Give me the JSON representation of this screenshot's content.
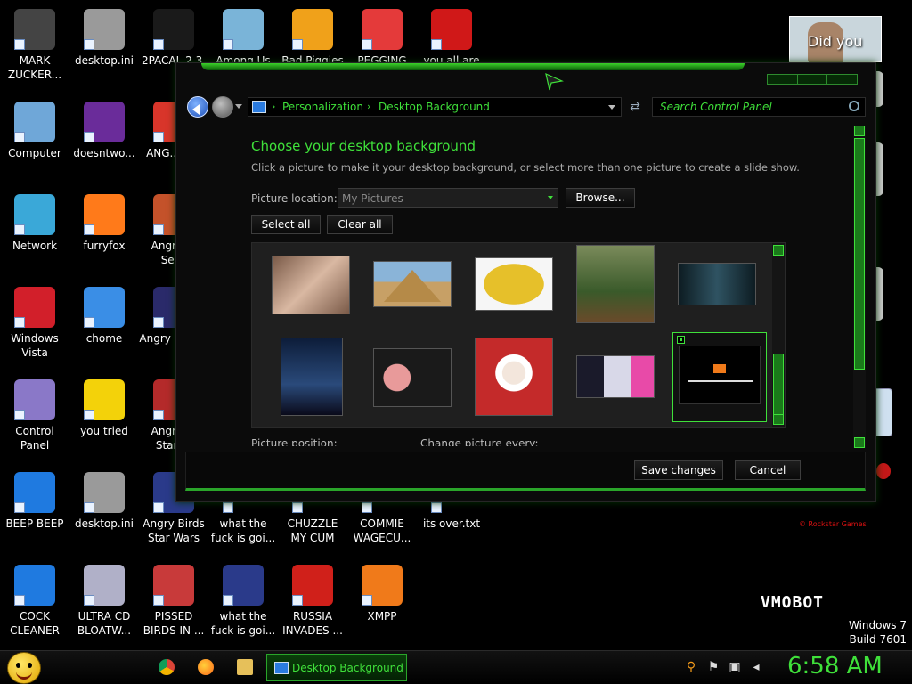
{
  "desktop": {
    "icons": [
      {
        "label": "MARK ZUCKER...",
        "icon": "person-icon",
        "color": "#444444"
      },
      {
        "label": "desktop.ini",
        "icon": "settings-file-icon",
        "color": "#9a9a9a"
      },
      {
        "label": "2PACAL 2.3.",
        "icon": "console-icon",
        "color": "#1a1a1a"
      },
      {
        "label": "Among Us",
        "icon": "game-icon",
        "color": "#7ab4d8"
      },
      {
        "label": "Bad Piggies",
        "icon": "pig-icon",
        "color": "#f0a11a"
      },
      {
        "label": "PEGGING",
        "icon": "p-logo-icon",
        "color": "#e43a3a"
      },
      {
        "label": "you all are",
        "icon": "devcpp-icon",
        "color": "#d01818"
      },
      {
        "label": "Computer",
        "icon": "computer-icon",
        "color": "#6fa7d8"
      },
      {
        "label": "doesntwo...",
        "icon": "yahoo-icon",
        "color": "#6a2c9a"
      },
      {
        "label": "ANG... BIR",
        "icon": "angry-bird-icon",
        "color": "#d8352a"
      },
      {
        "label": "Network",
        "icon": "network-globe-icon",
        "color": "#3aa8d8"
      },
      {
        "label": "furryfox",
        "icon": "firefox-icon",
        "color": "#ff7a1a"
      },
      {
        "label": "Angry ... Seas",
        "icon": "angry-birds-seasons-icon",
        "color": "#c4522a"
      },
      {
        "label": "Windows Vista",
        "icon": "recycle-bin-icon",
        "color": "#d21f2a"
      },
      {
        "label": "chome",
        "icon": "chrome-icon",
        "color": "#3a8ee6"
      },
      {
        "label": "Angry ... Spa",
        "icon": "angry-birds-space-icon",
        "color": "#2a2a6a"
      },
      {
        "label": "Control Panel",
        "icon": "control-panel-icon",
        "color": "#8a78c8"
      },
      {
        "label": "you tried",
        "icon": "star-icon",
        "color": "#f3d20a"
      },
      {
        "label": "Angry ... Star W",
        "icon": "angry-birds-star-wars-icon",
        "color": "#b42a2a"
      },
      {
        "label": "BEEP BEEP",
        "icon": "blue-bar-icon",
        "color": "#1f7ae0"
      },
      {
        "label": "desktop.ini",
        "icon": "settings-file-icon",
        "color": "#9a9a9a"
      },
      {
        "label": "Angry Birds Star Wars",
        "icon": "angry-birds-star-wars-icon",
        "color": "#2a3a8a"
      },
      {
        "label": "what the fuck is goi...",
        "icon": "blank-icon",
        "color": "#000000"
      },
      {
        "label": "CHUZZLE MY CUM",
        "icon": "blank-icon",
        "color": "#000000"
      },
      {
        "label": "COMMIE WAGECU...",
        "icon": "blank-icon",
        "color": "#000000"
      },
      {
        "label": "its over.txt",
        "icon": "blank-icon",
        "color": "#000000"
      },
      {
        "label": "COCK CLEANER",
        "icon": "blue-bar-icon",
        "color": "#1f7ae0"
      },
      {
        "label": "ULTRA CD BLOATW...",
        "icon": "cd-icon",
        "color": "#b0b0c8"
      },
      {
        "label": "PISSED BIRDS IN ...",
        "icon": "angry-bird-icon",
        "color": "#c83a3a"
      },
      {
        "label": "what the fuck is goi...",
        "icon": "angry-birds-space-icon",
        "color": "#2a3a8a"
      },
      {
        "label": "RUSSIA INVADES ...",
        "icon": "radiation-icon",
        "color": "#d0201a"
      },
      {
        "label": "XMPP",
        "icon": "xampp-icon",
        "color": "#f07a1a"
      }
    ],
    "did_you_text": "Did you",
    "watermark_small": "© Rockstar Games",
    "vmobot": "VMOBOT",
    "windows_version": "Windows 7",
    "build": "Build 7601"
  },
  "window": {
    "breadcrumb": [
      "Personalization",
      "Desktop Background"
    ],
    "search_placeholder": "Search Control Panel",
    "title": "Choose your desktop background",
    "subtitle": "Click a picture to make it your desktop background, or select more than one picture to create a slide show.",
    "picture_location_label": "Picture location:",
    "picture_location_value": "My Pictures",
    "browse_label": "Browse...",
    "select_all_label": "Select all",
    "clear_all_label": "Clear all",
    "picture_position_label": "Picture position:",
    "change_picture_label": "Change picture every:",
    "save_label": "Save changes",
    "cancel_label": "Cancel",
    "accent_color": "#3fe03a",
    "thumbnails": [
      {
        "name": "thumb-skin",
        "color": "#c9a58a"
      },
      {
        "name": "thumb-pyramid",
        "color": "#b8a36a"
      },
      {
        "name": "thumb-usa-map",
        "color": "#e6c02a"
      },
      {
        "name": "thumb-saint-portrait",
        "color": "#6a8a4a"
      },
      {
        "name": "thumb-dark-scene",
        "color": "#2a4a5a"
      },
      {
        "name": "thumb-morbius-poster",
        "color": "#1a3a6a"
      },
      {
        "name": "thumb-cartoon-pig",
        "color": "#e07a7a"
      },
      {
        "name": "thumb-santa",
        "color": "#c82a2a"
      },
      {
        "name": "thumb-collage",
        "color": "#8a8aa8"
      },
      {
        "name": "thumb-game-screen",
        "color": "#000000"
      }
    ]
  },
  "taskbar": {
    "active_task": "Desktop Background",
    "clock": "6:58 AM"
  }
}
